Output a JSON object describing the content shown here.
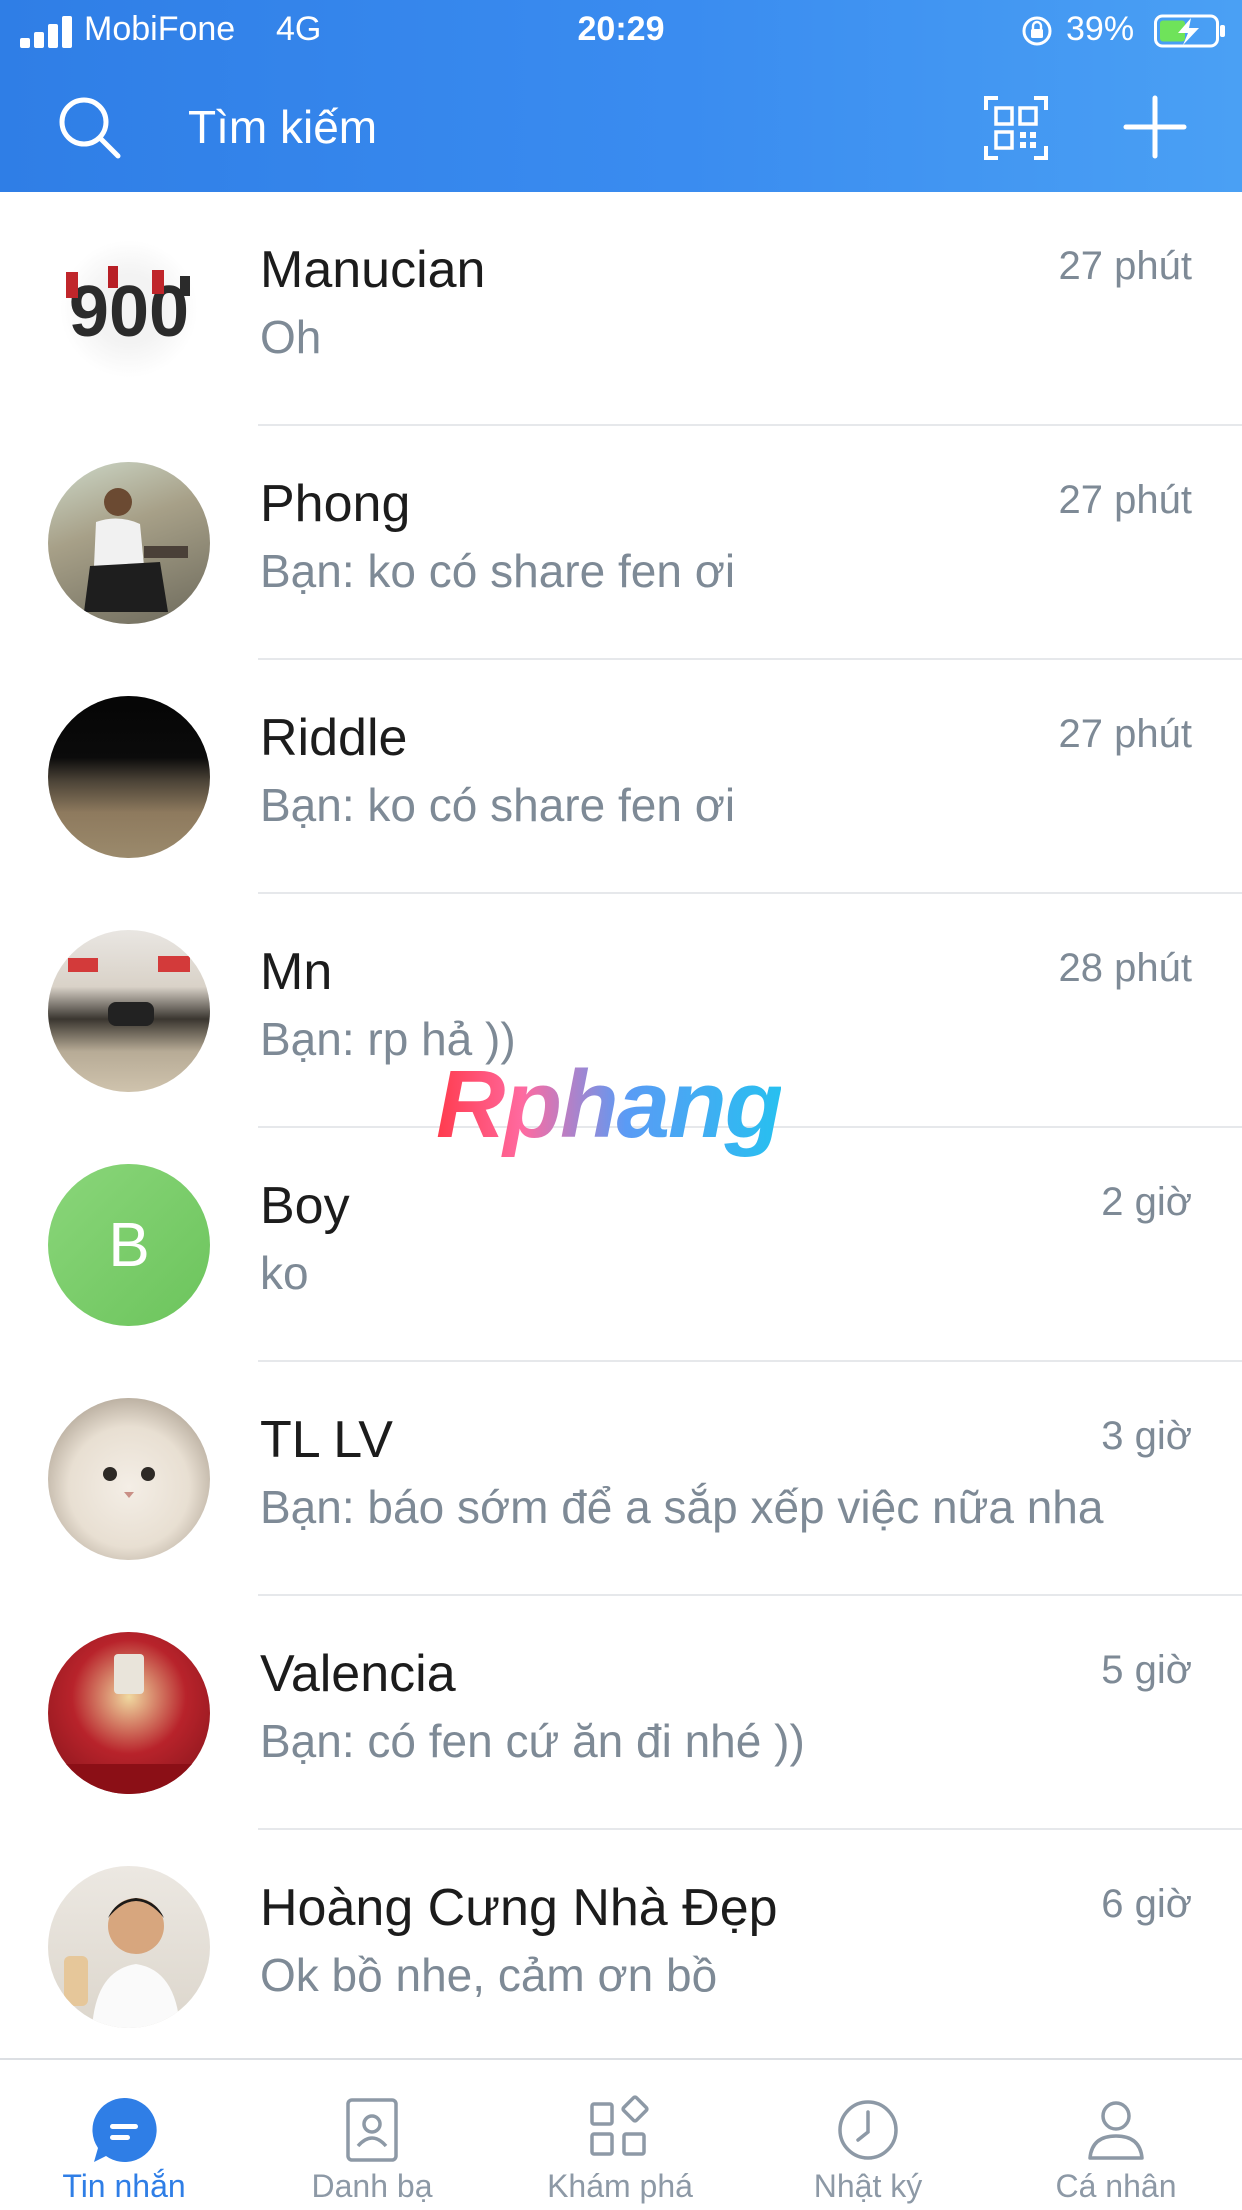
{
  "status_bar": {
    "carrier": "MobiFone",
    "network": "4G",
    "time": "20:29",
    "battery": "39%"
  },
  "search": {
    "placeholder": "Tìm kiếm"
  },
  "conversations": [
    {
      "name": "Manucian",
      "message": "Oh",
      "time": "27 phút",
      "avatar": "photo"
    },
    {
      "name": "Phong",
      "message": "Bạn: ko có share fen ơi",
      "time": "27 phút",
      "avatar": "photo"
    },
    {
      "name": "Riddle",
      "message": "Bạn: ko có share fen ơi",
      "time": "27 phút",
      "avatar": "photo"
    },
    {
      "name": "Mn",
      "message": "Bạn: rp hả ))",
      "time": "28 phút",
      "avatar": "photo"
    },
    {
      "name": "Boy",
      "message": "ko",
      "time": "2 giờ",
      "avatar": "letter",
      "avatar_letter": "B",
      "avatar_color": "#7cc96a"
    },
    {
      "name": "TL LV",
      "message": "Bạn: báo sớm để a sắp xếp việc nữa nha",
      "time": "3 giờ",
      "avatar": "photo"
    },
    {
      "name": "Valencia",
      "message": "Bạn: có fen cứ ăn đi nhé ))",
      "time": "5 giờ",
      "avatar": "photo"
    },
    {
      "name": "Hoàng Cưng Nhà Đẹp",
      "message": "Ok bồ nhe, cảm ơn bồ",
      "time": "6 giờ",
      "avatar": "photo"
    }
  ],
  "watermark": "Rphang",
  "tabs": [
    {
      "label": "Tin nhắn",
      "icon": "chat-bubble-icon",
      "active": true
    },
    {
      "label": "Danh bạ",
      "icon": "contacts-icon",
      "active": false
    },
    {
      "label": "Khám phá",
      "icon": "discover-grid-icon",
      "active": false
    },
    {
      "label": "Nhật ký",
      "icon": "clock-icon",
      "active": false
    },
    {
      "label": "Cá nhân",
      "icon": "person-icon",
      "active": false
    }
  ],
  "colors": {
    "header": "#3a8cf0",
    "accent": "#2f7ee6",
    "secondary_text": "#7e8a96"
  }
}
